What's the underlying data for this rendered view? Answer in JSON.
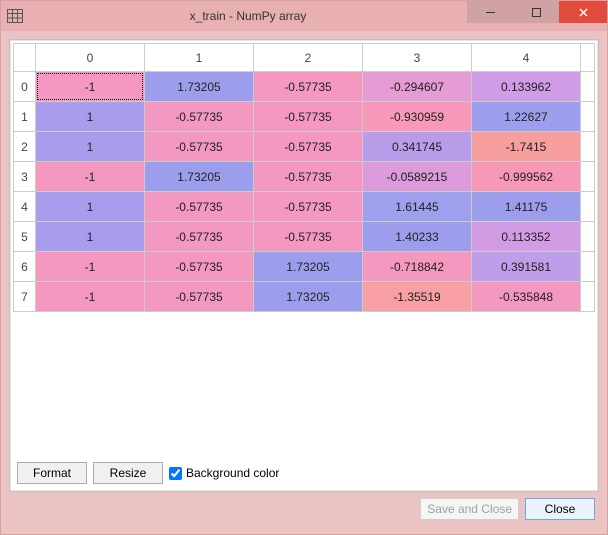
{
  "window": {
    "title": "x_train - NumPy array"
  },
  "chart_data": {
    "type": "table",
    "title": "x_train - NumPy array",
    "columns": [
      "0",
      "1",
      "2",
      "3",
      "4"
    ],
    "row_index": [
      "0",
      "1",
      "2",
      "3",
      "4",
      "5",
      "6",
      "7"
    ],
    "values": [
      [
        -1,
        1.73205,
        -0.57735,
        -0.294607,
        0.133962
      ],
      [
        1,
        -0.57735,
        -0.57735,
        -0.930959,
        1.22627
      ],
      [
        1,
        -0.57735,
        -0.57735,
        0.341745,
        -1.7415
      ],
      [
        -1,
        1.73205,
        -0.57735,
        -0.0589215,
        -0.999562
      ],
      [
        1,
        -0.57735,
        -0.57735,
        1.61445,
        1.41175
      ],
      [
        1,
        -0.57735,
        -0.57735,
        1.40233,
        0.113352
      ],
      [
        -1,
        -0.57735,
        1.73205,
        -0.718842,
        0.391581
      ],
      [
        -1,
        -0.57735,
        1.73205,
        -1.35519,
        -0.535848
      ]
    ],
    "cell_colors": [
      [
        "#f598c1",
        "#9d9ded",
        "#f498c1",
        "#e59bd3",
        "#d09ce6"
      ],
      [
        "#a89dec",
        "#f398c1",
        "#f498c1",
        "#f898ba",
        "#9d9eed"
      ],
      [
        "#a89dec",
        "#f398c1",
        "#f498c1",
        "#b99ce9",
        "#f79e9e"
      ],
      [
        "#f598c1",
        "#9d9ded",
        "#f498c1",
        "#dc9bdb",
        "#f898b8"
      ],
      [
        "#a89dec",
        "#f398c1",
        "#f498c1",
        "#9e9fed",
        "#9d9ded"
      ],
      [
        "#a89dec",
        "#f398c1",
        "#f498c1",
        "#9e9ded",
        "#d29ce5"
      ],
      [
        "#f598c1",
        "#f498c1",
        "#9d9ded",
        "#f598c0",
        "#be9de9"
      ],
      [
        "#f598c1",
        "#f398c1",
        "#9d9ded",
        "#f79fa3",
        "#f398c1"
      ]
    ],
    "selected": {
      "row": 0,
      "col": 0
    }
  },
  "toolbar": {
    "format_label": "Format",
    "resize_label": "Resize",
    "bgcolor_label": "Background color",
    "bgcolor_checked": true
  },
  "footer": {
    "save_and_close_label": "Save and Close",
    "save_and_close_enabled": false,
    "close_label": "Close"
  }
}
